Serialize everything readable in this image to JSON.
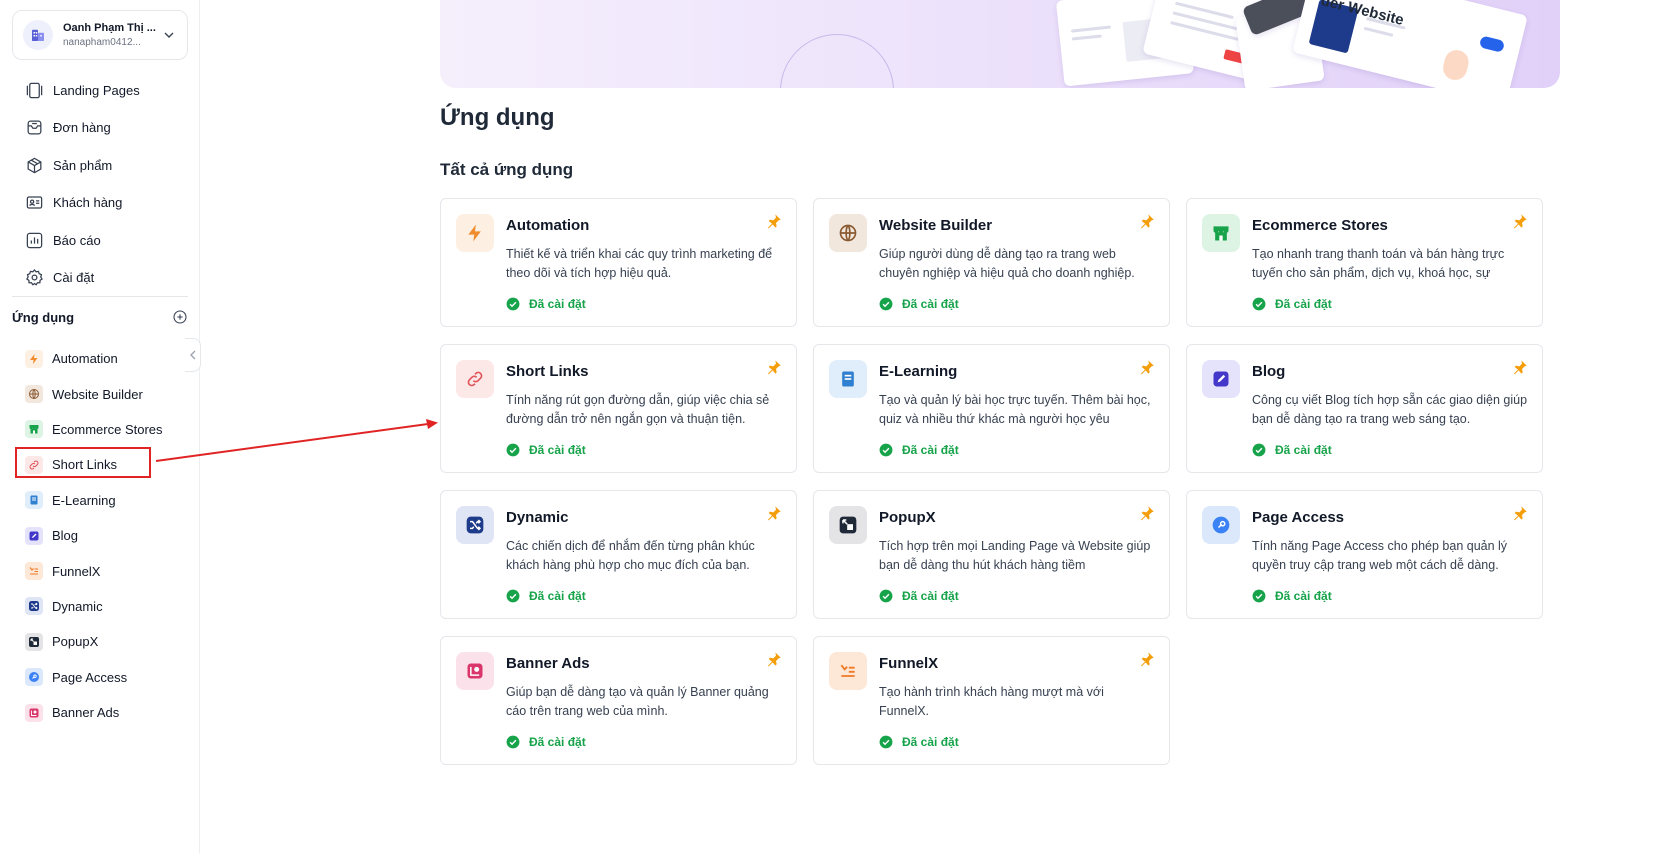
{
  "account": {
    "name": "Oanh Phạm Thị ...",
    "email": "nanapham0412..."
  },
  "nav": [
    {
      "label": "Landing Pages",
      "icon": "landing-pages-icon"
    },
    {
      "label": "Đơn hàng",
      "icon": "orders-icon"
    },
    {
      "label": "Sản phẩm",
      "icon": "products-icon"
    },
    {
      "label": "Khách hàng",
      "icon": "customers-icon"
    },
    {
      "label": "Báo cáo",
      "icon": "reports-icon"
    },
    {
      "label": "Cài đặt",
      "icon": "settings-icon"
    }
  ],
  "sidebar_apps": {
    "title": "Ứng dụng",
    "items": [
      {
        "label": "Automation",
        "icon": "bolt-icon"
      },
      {
        "label": "Website Builder",
        "icon": "globe-icon"
      },
      {
        "label": "Ecommerce Stores",
        "icon": "store-icon"
      },
      {
        "label": "Short Links",
        "icon": "link-icon"
      },
      {
        "label": "E-Learning",
        "icon": "book-icon"
      },
      {
        "label": "Blog",
        "icon": "pen-icon"
      },
      {
        "label": "FunnelX",
        "icon": "funnel-icon"
      },
      {
        "label": "Dynamic",
        "icon": "shuffle-icon"
      },
      {
        "label": "PopupX",
        "icon": "popup-icon"
      },
      {
        "label": "Page Access",
        "icon": "key-icon"
      },
      {
        "label": "Banner Ads",
        "icon": "banner-icon"
      }
    ]
  },
  "banner": {
    "heading_fragment": "der Website"
  },
  "main": {
    "title": "Ứng dụng",
    "section_title": "Tất cả ứng dụng",
    "cards": [
      {
        "title": "Automation",
        "desc": "Thiết kế và triển khai các quy trình marketing để theo dõi và tích hợp hiệu quả.",
        "status": "Đã cài đặt",
        "icon": "bolt-icon"
      },
      {
        "title": "Website Builder",
        "desc": "Giúp người dùng dễ dàng tạo ra trang web chuyên nghiệp và hiệu quả cho doanh nghiệp.",
        "status": "Đã cài đặt",
        "icon": "globe-icon"
      },
      {
        "title": "Ecommerce Stores",
        "desc": "Tạo nhanh trang thanh toán và bán hàng trực tuyến cho sản phẩm, dịch vụ, khoá học, sự",
        "status": "Đã cài đặt",
        "icon": "store-icon"
      },
      {
        "title": "Short Links",
        "desc": "Tính năng rút gọn đường dẫn, giúp việc chia sẻ đường dẫn trở nên ngắn gọn và thuận tiện.",
        "status": "Đã cài đặt",
        "icon": "link-icon"
      },
      {
        "title": "E-Learning",
        "desc": "Tạo và quản lý bài học trực tuyến. Thêm bài học, quiz và nhiều thứ khác mà người học yêu",
        "status": "Đã cài đặt",
        "icon": "book-icon"
      },
      {
        "title": "Blog",
        "desc": "Công cụ viết Blog tích hợp sẵn các giao diện giúp bạn dễ dàng tạo ra trang web sáng tạo.",
        "status": "Đã cài đặt",
        "icon": "pen-icon"
      },
      {
        "title": "Dynamic",
        "desc": "Các chiến dịch để nhắm đến từng phân khúc khách hàng phù hợp cho mục đích của bạn.",
        "status": "Đã cài đặt",
        "icon": "shuffle-icon"
      },
      {
        "title": "PopupX",
        "desc": "Tích hợp trên mọi Landing Page và Website giúp bạn dễ dàng thu hút khách hàng tiềm",
        "status": "Đã cài đặt",
        "icon": "popup-icon"
      },
      {
        "title": "Page Access",
        "desc": "Tính năng Page Access cho phép bạn quản lý quyền truy cập trang web một cách dễ dàng.",
        "status": "Đã cài đặt",
        "icon": "key-icon"
      },
      {
        "title": "Banner Ads",
        "desc": "Giúp bạn dễ dàng tạo và quản lý Banner quảng cáo trên trang web của mình.",
        "status": "Đã cài đặt",
        "icon": "banner-icon"
      },
      {
        "title": "FunnelX",
        "desc": "Tạo hành trình khách hàng mượt mà với FunnelX.",
        "status": "Đã cài đặt",
        "icon": "funnel-icon"
      }
    ]
  },
  "colors": {
    "accent_green": "#16a34a",
    "pin_orange": "#f59e0b",
    "highlight_red": "#e02424"
  }
}
